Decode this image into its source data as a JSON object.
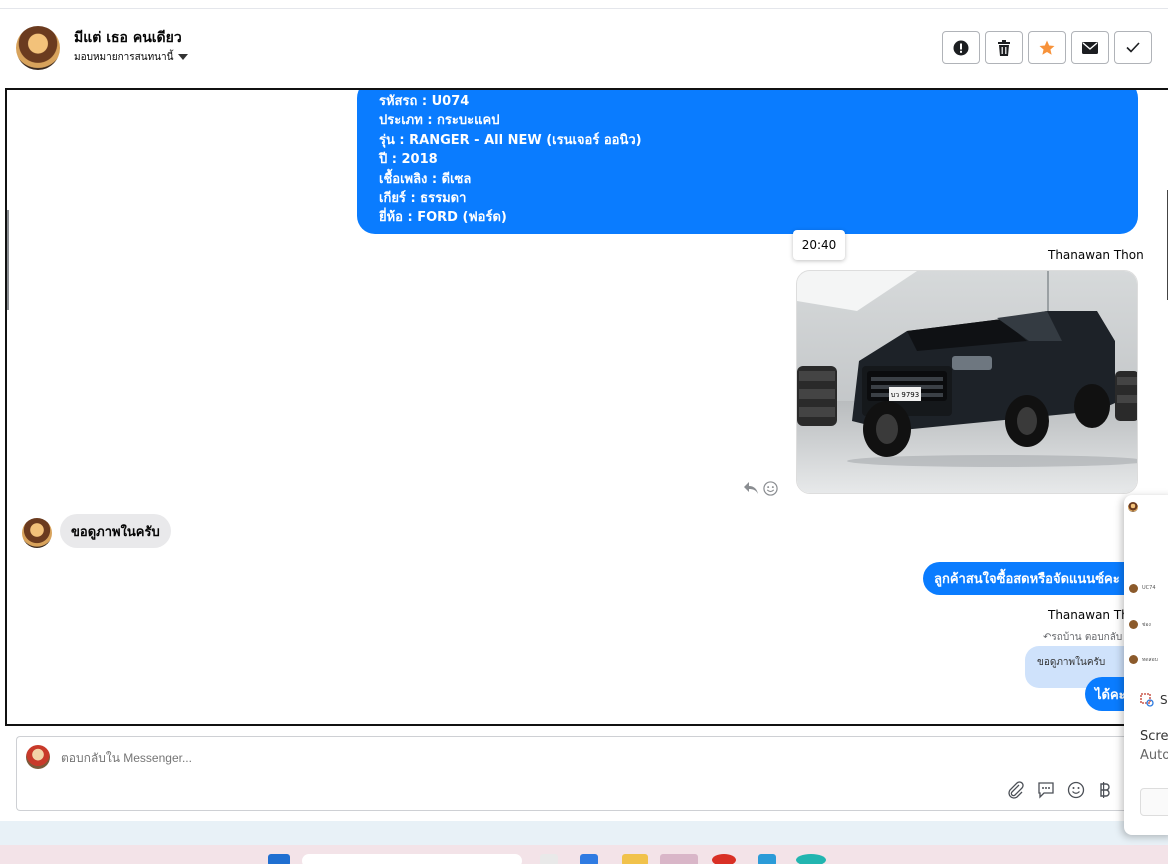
{
  "header": {
    "name": "มีแต่ เธอ คนเดียว",
    "assign_label": "มอบหมายการสนทนานี้",
    "actions": [
      "report-icon",
      "trash-icon",
      "star-icon",
      "mail-icon",
      "check-icon"
    ]
  },
  "chat": {
    "card_lines": [
      "รหัสรถ : U074",
      "ประเภท : กระบะแคป",
      "รุ่น : RANGER - All NEW (เรนเจอร์ ออนิว)",
      "ปี : 2018",
      "เชื้อเพลิง : ดีเซล",
      "เกียร์ : ธรรมดา",
      "ยี่ห้อ : FORD (ฟอร์ด)"
    ],
    "time_tooltip": "20:40",
    "sender_name": "Thanawan Thon",
    "sender_name_2": "Thanawan Tho",
    "plate_text": "บว 9793",
    "incoming_message": "ขอดูภาพในครับ",
    "outgoing_message": "ลูกค้าสนใจซื้อสดหรือจัดแนนซ์คะ",
    "reply_note": "ตอบกลับ มี",
    "reply_note_prefix": "รถบ้าน",
    "quoted_text": "ขอดูภาพในครับ",
    "outgoing_message_2": "ได้คะ"
  },
  "composer": {
    "placeholder": "ตอบกลับใน Messenger..."
  },
  "notification": {
    "title_fragment": "S",
    "line1": "Scree",
    "line2": "Auto",
    "tiny_items": [
      "UC74",
      "ช่อง",
      "ทดสอบ"
    ]
  }
}
